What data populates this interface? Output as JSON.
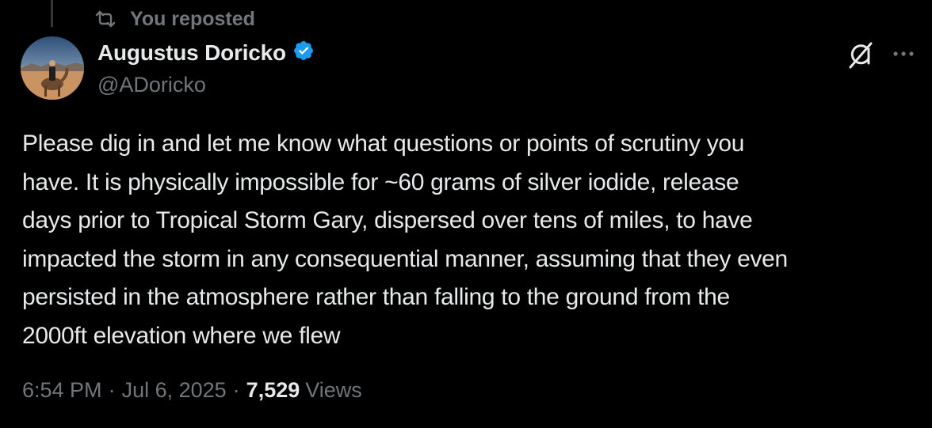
{
  "repost": {
    "label": "You reposted",
    "icon": "repost-icon"
  },
  "author": {
    "display_name": "Augustus Doricko",
    "handle": "@ADoricko",
    "verified": true,
    "verified_color": "#1d9bf0"
  },
  "actions": {
    "grok_icon": "grok-icon",
    "more_icon": "more-options-icon"
  },
  "tweet": {
    "text": "Please dig in and let me know what questions or points of scrutiny you\nhave. It is physically impossible for ~60 grams of silver iodide, release\ndays prior to Tropical Storm Gary, dispersed over tens of miles, to have\nimpacted the storm in any consequential manner, assuming that they even\npersisted in the atmosphere rather than falling to the ground from the\n2000ft elevation where we flew"
  },
  "meta": {
    "time": "6:54 PM",
    "separator": "·",
    "date": "Jul 6, 2025",
    "view_count": "7,529",
    "views_label": "Views"
  },
  "colors": {
    "background": "#000000",
    "primary_text": "#e7e9ea",
    "secondary_text": "#71767b",
    "accent": "#1d9bf0"
  }
}
